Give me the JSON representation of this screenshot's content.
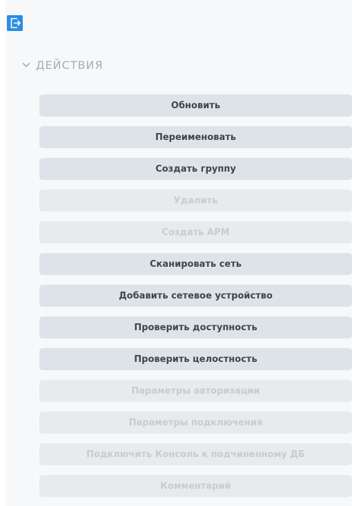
{
  "toolbar": {
    "collapse_icon": "exit-arrow-icon",
    "accent_color": "#2b8de3"
  },
  "section": {
    "title": "ДЕЙСТВИЯ",
    "expanded": true,
    "chevron_icon": "chevron-down-icon"
  },
  "actions": [
    {
      "label": "Обновить",
      "enabled": true
    },
    {
      "label": "Переименовать",
      "enabled": true
    },
    {
      "label": "Создать группу",
      "enabled": true
    },
    {
      "label": "Удалить",
      "enabled": false
    },
    {
      "label": "Создать АРМ",
      "enabled": false
    },
    {
      "label": "Сканировать сеть",
      "enabled": true
    },
    {
      "label": "Добавить сетевое устройство",
      "enabled": true
    },
    {
      "label": "Проверить доступность",
      "enabled": true
    },
    {
      "label": "Проверить целостность",
      "enabled": true
    },
    {
      "label": "Параметры авторизации",
      "enabled": false
    },
    {
      "label": "Параметры подключения",
      "enabled": false
    },
    {
      "label": "Подключить Консоль к подчиненному ДБ",
      "enabled": false
    },
    {
      "label": "Комментарий",
      "enabled": false
    }
  ]
}
